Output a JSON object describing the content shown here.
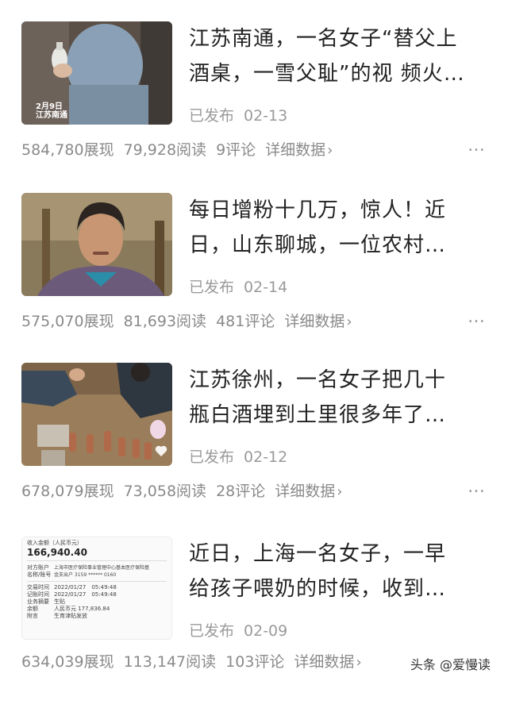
{
  "articles": [
    {
      "title_line1": "江苏南通，一名女子“替父上",
      "title_line2": "酒桌，一雪父耻”的视 频火…",
      "status": "已发布",
      "date": "02-13",
      "views": "584,780展现",
      "reads": "79,928阅读",
      "comments": "9评论",
      "detail": "详细数据",
      "thumb_caption_date": "2月9日",
      "thumb_caption_place": "江苏南通"
    },
    {
      "title_line1": "每日增粉十几万，惊人！近",
      "title_line2": "日，山东聊城，一位农村…",
      "status": "已发布",
      "date": "02-14",
      "views": "575,070展现",
      "reads": "81,693阅读",
      "comments": "481评论",
      "detail": "详细数据"
    },
    {
      "title_line1": "江苏徐州，一名女子把几十",
      "title_line2": "瓶白酒埋到土里很多年了…",
      "status": "已发布",
      "date": "02-12",
      "views": "678,079展现",
      "reads": "73,058阅读",
      "comments": "28评论",
      "detail": "详细数据"
    },
    {
      "title_line1": "近日，上海一名女子，一早",
      "title_line2": "给孩子喂奶的时候，收到…",
      "status": "已发布",
      "date": "02-09",
      "views": "634,039展现",
      "reads": "113,147阅读",
      "comments": "103评论",
      "detail": "详细数据",
      "doc": {
        "amount_label": "收入金额（人民币元）",
        "amount": "166,940.40",
        "row1_label": "对方账户",
        "row1_label2": "名称/账号",
        "row1_value": "上海市医疗保险事业管理中心基本医疗保险基",
        "row1_value2": "金支出户 3159 ****** 0160",
        "r2_label": "交易时间",
        "r2_value": "2022/01/27　05:49:48",
        "r3_label": "记账时间",
        "r3_value": "2022/01/27　05:49:48",
        "r4_label": "业务摘要",
        "r4_value": "生贴",
        "r5_label": "余额",
        "r5_value": "人民币元 177,836.84",
        "r6_label": "附言",
        "r6_value": "生育津贴发放"
      }
    }
  ],
  "more_icon": "…",
  "watermark": "头条 @爱慢读"
}
